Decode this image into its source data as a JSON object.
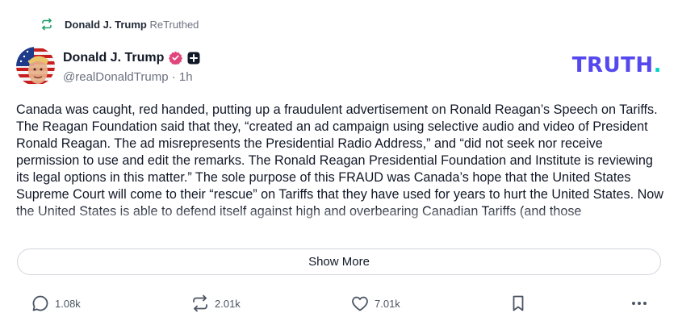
{
  "retruth": {
    "name": "Donald J. Trump",
    "suffix": "ReTruthed"
  },
  "post": {
    "author_name": "Donald J. Trump",
    "handle": "@realDonaldTrump",
    "separator": "·",
    "time": "1h",
    "text": "Canada was caught, red handed, putting up a fraudulent advertisement on Ronald Reagan’s Speech on Tariffs. The Reagan Foundation said that they, “created an ad campaign using selective audio and video of President Ronald Reagan. The ad misrepresents the Presidential Radio Address,” and “did not seek nor receive permission to use and edit the remarks. The Ronald Reagan Presidential Foundation and Institute is reviewing its legal options in this matter.” The sole purpose of this FRAUD was Canada’s hope that the United States Supreme Court will come to their “rescue” on Tariffs that they have used for years to hurt the United States. Now the United States is able to defend itself against high and overbearing Canadian Tariffs (and those",
    "show_more_label": "Show More"
  },
  "logo": {
    "main": "TRUTH",
    "dot": "."
  },
  "actions": {
    "replies": "1.08k",
    "retruths": "2.01k",
    "likes": "7.01k"
  },
  "colors": {
    "brand_purple": "#5448ee",
    "brand_teal": "#00d4c3",
    "retruth_green": "#22a06b",
    "verified_pink": "#e0457b"
  },
  "icons": {
    "retruth": "retruth-icon",
    "verified": "verified-badge-icon",
    "plus": "plus-badge-icon",
    "reply": "comment-icon",
    "repost": "retruth-icon",
    "like": "heart-icon",
    "save": "bookmark-icon",
    "more": "more-dots-icon"
  }
}
